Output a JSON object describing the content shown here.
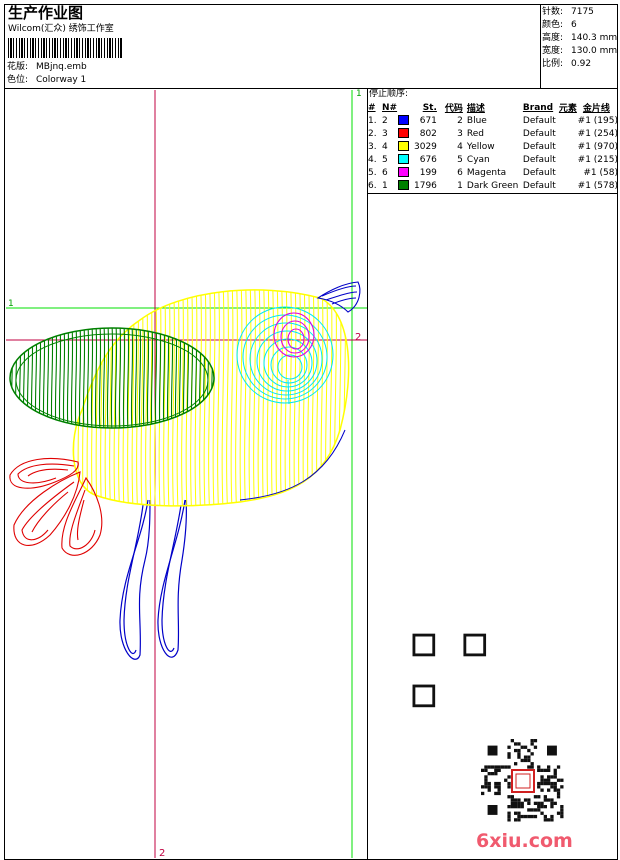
{
  "header": {
    "title": "生产作业图",
    "company": "Wilcom(汇众) 绣饰工作室",
    "design_label": "花版:",
    "design_value": "MBjnq.emb",
    "colorway_label": "色位:",
    "colorway_value": "Colorway 1"
  },
  "info": {
    "stitches_label": "针数:",
    "stitches_value": "7175",
    "colors_label": "颜色:",
    "colors_value": "6",
    "height_label": "高度:",
    "height_value": "140.3 mm",
    "width_label": "宽度:",
    "width_value": "130.0 mm",
    "scale_label": "比例:",
    "scale_value": "0.92"
  },
  "stop_sequence": {
    "title": "停止顺序:",
    "headers": [
      "#",
      "N#",
      "St.",
      "代码",
      "描述",
      "Brand",
      "元素",
      "金片线"
    ],
    "rows": [
      {
        "num": "1.",
        "n": "2",
        "color": "#0000ff",
        "st": "671",
        "code": "2",
        "desc": "Blue",
        "brand": "Default",
        "element": "#1 (195)"
      },
      {
        "num": "2.",
        "n": "3",
        "color": "#ff0000",
        "st": "802",
        "code": "3",
        "desc": "Red",
        "brand": "Default",
        "element": "#1 (254)"
      },
      {
        "num": "3.",
        "n": "4",
        "color": "#ffff00",
        "st": "3029",
        "code": "4",
        "desc": "Yellow",
        "brand": "Default",
        "element": "#1 (970)"
      },
      {
        "num": "4.",
        "n": "5",
        "color": "#00ffff",
        "st": "676",
        "code": "5",
        "desc": "Cyan",
        "brand": "Default",
        "element": "#1 (215)"
      },
      {
        "num": "5.",
        "n": "6",
        "color": "#ff00ff",
        "st": "199",
        "code": "6",
        "desc": "Magenta",
        "brand": "Default",
        "element": "#1 (58)"
      },
      {
        "num": "6.",
        "n": "1",
        "color": "#008000",
        "st": "1796",
        "code": "1",
        "desc": "Dark Green",
        "brand": "Default",
        "element": "#1 (578)"
      }
    ]
  },
  "guides": {
    "green_v_label": "1",
    "green_h_label": "1",
    "red_h_label": "2",
    "red_v_label": "2"
  },
  "watermark": {
    "text": "6xiu.com"
  },
  "colors": {
    "blue": "#0000c8",
    "red": "#e00000",
    "yellow": "#ffff00",
    "cyan": "#00e8f0",
    "magenta": "#e000e0",
    "green": "#008000",
    "guide_green": "#00e000",
    "guide_red": "#c00040"
  }
}
